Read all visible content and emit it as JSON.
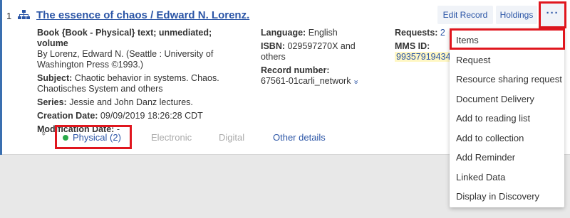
{
  "record": {
    "number": "1",
    "title": "The essence of chaos / Edward N. Lorenz.",
    "col1": {
      "type_line": "Book {Book - Physical} text; unmediated; volume",
      "author_line1": "By Lorenz, Edward N. (Seattle : University of",
      "author_line2": "Washington Press ©1993.)",
      "subject_label": "Subject:",
      "subject_line1": "Chaotic behavior in systems. Chaos.",
      "subject_line2": "Chaotisches System and others",
      "series_label": "Series:",
      "series_value": "Jessie and John Danz lectures.",
      "creation_label": "Creation Date:",
      "creation_value": "09/09/2019 18:26:28 CDT",
      "modification_label": "Modification Date:",
      "modification_value": "-"
    },
    "col2": {
      "language_label": "Language:",
      "language_value": "English",
      "isbn_label": "ISBN:",
      "isbn_value1": "029597270X and",
      "isbn_value2": "others",
      "record_label": "Record number:",
      "record_value": "67561-01carli_network"
    },
    "col3": {
      "requests_label": "Requests:",
      "requests_value": "2",
      "mms_label": "MMS ID:",
      "mms_value": "99357919434"
    }
  },
  "toolbar": {
    "edit_label": "Edit Record",
    "holdings_label": "Holdings",
    "more_label": "···"
  },
  "tabs": {
    "physical": "Physical (2)",
    "electronic": "Electronic",
    "digital": "Digital",
    "other": "Other details"
  },
  "icons": {
    "expand": "»",
    "record_link": "»"
  },
  "menu": {
    "items": [
      "Items",
      "Request",
      "Resource sharing request",
      "Document Delivery",
      "Add to reading list",
      "Add to collection",
      "Add Reminder",
      "Linked Data",
      "Display in Discovery"
    ]
  },
  "colors": {
    "accent": "#2b55a6",
    "highlight": "#e0161e",
    "available": "#2aa94a"
  }
}
